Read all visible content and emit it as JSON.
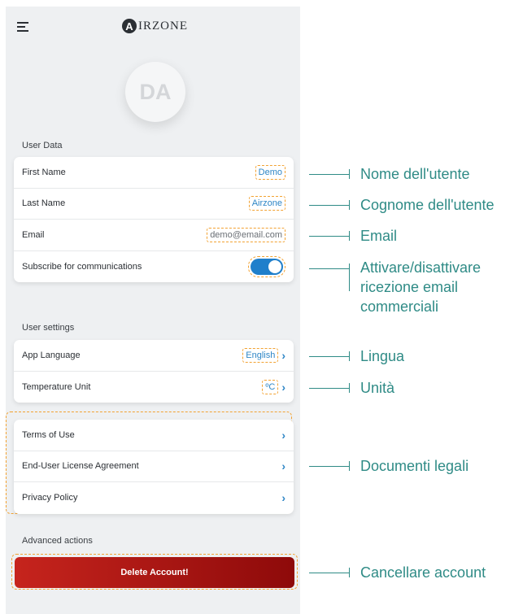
{
  "header": {
    "logo_letter": "A",
    "logo_rest": "IRZONE"
  },
  "avatar": {
    "initials": "DA"
  },
  "user_data": {
    "title": "User Data",
    "rows": [
      {
        "label": "First Name",
        "value": "Demo"
      },
      {
        "label": "Last Name",
        "value": "Airzone"
      },
      {
        "label": "Email",
        "value": "demo@email.com"
      },
      {
        "label": "Subscribe for communications",
        "toggle_on": true
      }
    ]
  },
  "user_settings": {
    "title": "User settings",
    "rows": [
      {
        "label": "App Language",
        "value": "English"
      },
      {
        "label": "Temperature Unit",
        "value": "ºC"
      }
    ]
  },
  "legal": {
    "rows": [
      {
        "label": "Terms of Use"
      },
      {
        "label": "End-User License Agreement"
      },
      {
        "label": "Privacy Policy"
      }
    ]
  },
  "advanced": {
    "title": "Advanced actions",
    "delete_label": "Delete Account!"
  },
  "annotations": {
    "first_name": "Nome dell'utente",
    "last_name": "Cognome dell'utente",
    "email": "Email",
    "subscribe": [
      "Attivare/disattivare",
      "ricezione email",
      "commerciali"
    ],
    "language": "Lingua",
    "unit": "Unità",
    "legal": "Documenti legali",
    "delete": "Cancellare account"
  },
  "colors": {
    "accent": "#2e86c6",
    "annotation": "#2f8b86",
    "highlight": "#f2a232",
    "danger": "#c6241d"
  }
}
